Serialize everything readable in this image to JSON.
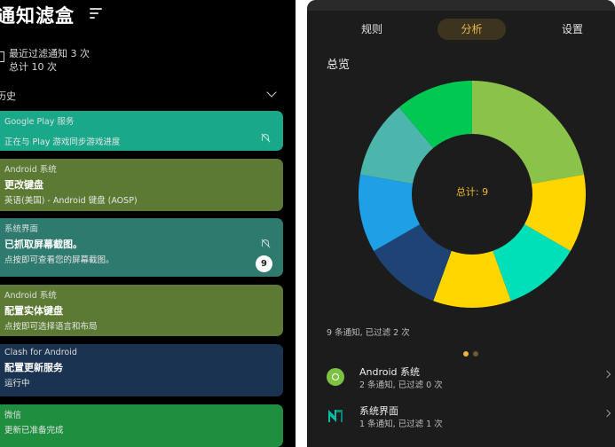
{
  "left": {
    "app_title": "通知滤盒",
    "stats": {
      "line1": "最近过滤通知 3 次",
      "line2": "总计 10 次"
    },
    "history_label": "历史",
    "cards": [
      {
        "app": "Google Play 服务",
        "title": "",
        "body": "正在与 Play 游戏同步游戏进度",
        "color": "#1aa88a",
        "muted": true
      },
      {
        "app": "Android 系统",
        "title": "更改键盘",
        "body": "英语(美国) - Android 键盘 (AOSP)",
        "color": "#5c7a33"
      },
      {
        "app": "系统界面",
        "title": "已抓取屏幕截图。",
        "body": "点按即可查看您的屏幕截图。",
        "color": "#2f7a6e",
        "muted": true,
        "badge": "9"
      },
      {
        "app": "Android 系统",
        "title": "配置实体键盘",
        "body": "点按即可选择语言和布局",
        "color": "#5c7a33"
      },
      {
        "app": "Clash for Android",
        "title": "配置更新服务",
        "body": "运行中",
        "color": "#1a3350"
      },
      {
        "app": "微信",
        "title": "",
        "body": "更新已准备完成",
        "color": "#1f8e3e"
      }
    ]
  },
  "right": {
    "tabs": [
      "规则",
      "分析",
      "设置"
    ],
    "active_tab": "分析",
    "overview_title": "总览",
    "total_label": "总计: 9",
    "summary": "9 条通知, 已过滤 2 次",
    "apps": [
      {
        "name": "Android 系统",
        "sub": "2 条通知, 已过滤 0 次",
        "icon": "android-gear-icon"
      },
      {
        "name": "系统界面",
        "sub": "1 条通知, 已过滤 1 次",
        "icon": "system-ui-icon"
      }
    ]
  },
  "chart_data": {
    "type": "pie",
    "style": "donut",
    "center_label": "总计: 9",
    "slices": [
      {
        "value": 2,
        "color": "#8bc34a"
      },
      {
        "value": 1,
        "color": "#ffd600"
      },
      {
        "value": 1,
        "color": "#00e0b8"
      },
      {
        "value": 1,
        "color": "#ffd600"
      },
      {
        "value": 1,
        "color": "#1e4476"
      },
      {
        "value": 1,
        "color": "#1e9fe6"
      },
      {
        "value": 1,
        "color": "#4db6ac"
      },
      {
        "value": 1,
        "color": "#00c853"
      }
    ]
  }
}
